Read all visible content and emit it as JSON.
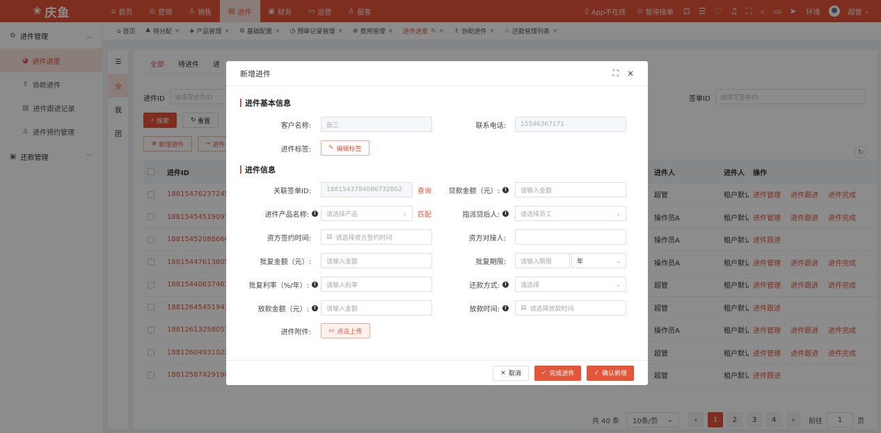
{
  "app": {
    "logo_text": "庆鱼"
  },
  "topnav": [
    {
      "label": "首页",
      "icon": "⌂"
    },
    {
      "label": "营销",
      "icon": "◎"
    },
    {
      "label": "销售",
      "icon": "♙"
    },
    {
      "label": "进件",
      "icon": "▤"
    },
    {
      "label": "财务",
      "icon": "▣"
    },
    {
      "label": "运营",
      "icon": "▭"
    },
    {
      "label": "服客",
      "icon": "♙"
    }
  ],
  "topright": {
    "app_status": "App不在线",
    "stop_accept": "暂停接单",
    "env": "环境",
    "user": "超管"
  },
  "sidebar": {
    "group1": "进件管理",
    "items": [
      "进件进度",
      "协助进件",
      "进件跟进记录",
      "进件预约管理"
    ],
    "group2": "还款管理"
  },
  "tabs": [
    {
      "label": "首页"
    },
    {
      "label": "待分配"
    },
    {
      "label": "产品管理"
    },
    {
      "label": "基础配置"
    },
    {
      "label": "预审记录管理"
    },
    {
      "label": "费用管理"
    },
    {
      "label": "进件进度"
    },
    {
      "label": "协助进件"
    },
    {
      "label": "还款管理列表"
    }
  ],
  "vtabs": [
    "全",
    "我",
    "团"
  ],
  "ptabs": [
    "全部",
    "待进件",
    "进"
  ],
  "filters": {
    "id_label": "进件ID",
    "id_placeholder": "请填写进件ID",
    "sign_label": "签单ID",
    "sign_placeholder": "请填写签单ID",
    "search": "搜索",
    "reset": "重置",
    "add": "新增进件",
    "more": "进件"
  },
  "table": {
    "headers": {
      "id": "进件ID",
      "person": "进件人",
      "type": "进件人",
      "ops": "操作"
    },
    "rows": [
      {
        "id": "1881547623724580",
        "person": "超管",
        "type": "租户默认",
        "ops": [
          "进件管理",
          "进件跟进",
          "进件完成"
        ]
      },
      {
        "id": "1881545451909770",
        "person": "操作员A",
        "type": "租户默认",
        "ops": [
          "进件管理",
          "进件跟进",
          "进件完成"
        ]
      },
      {
        "id": "1881545208866630",
        "person": "操作员A",
        "type": "租户默认",
        "ops": [
          "进件跟进"
        ]
      },
      {
        "id": "1881544761380530",
        "person": "操作员A",
        "type": "租户默认",
        "ops": [
          "进件管理",
          "进件跟进",
          "进件完成"
        ]
      },
      {
        "id": "1881544063746140",
        "person": "超管",
        "type": "租户默认",
        "ops": [
          "进件管理",
          "进件跟进",
          "进件完成"
        ]
      },
      {
        "id": "1881264545194140",
        "person": "超管",
        "type": "租户默认",
        "ops": [
          "进件跟进"
        ]
      },
      {
        "id": "1881261325805780",
        "person": "操作员A",
        "type": "租户默认",
        "ops": [
          "进件管理",
          "进件跟进",
          "进件完成"
        ]
      },
      {
        "id": "1881260493102210",
        "person": "超管",
        "type": "租户默认",
        "ops": [
          "进件管理",
          "进件跟进",
          "进件完成"
        ]
      },
      {
        "id": "1881258742919820",
        "person": "超管",
        "type": "租户默认",
        "ops": [
          "进件跟进"
        ]
      }
    ]
  },
  "pager": {
    "total": "共 40 条",
    "size": "10条/页",
    "pages": [
      "1",
      "2",
      "3",
      "4"
    ],
    "goto": "前往",
    "goto_val": "1",
    "unit": "页"
  },
  "modal": {
    "title": "新增进件",
    "sec1": "进件基本信息",
    "customer_label": "客户名称:",
    "customer_value": "张三",
    "phone_label": "联系电话:",
    "phone_value": "15546367171",
    "tag_label": "进件标签:",
    "tag_btn": "编辑标签",
    "sec2": "进件信息",
    "sign_label": "关联签单ID:",
    "sign_value": "1881543784086732802",
    "query": "查询",
    "loan_label": "贷款金额（元）:",
    "loan_ph": "请输入金额",
    "product_label": "进件产品名称:",
    "product_ph": "请选择产品",
    "match": "匹配",
    "assignee_label": "指派贷后人:",
    "assignee_ph": "请选择员工",
    "fund_sign_label": "资方签约时间:",
    "fund_sign_ph": "请选择资方签约时间",
    "fund_contact_label": "资方对接人:",
    "approve_amt_label": "批复金额（元）:",
    "approve_amt_ph": "请输入金额",
    "approve_term_label": "批复期限:",
    "approve_term_ph": "请输入期限",
    "term_unit": "年",
    "rate_label": "批复利率（%/年）:",
    "rate_ph": "请输入利率",
    "repay_label": "还款方式:",
    "repay_ph": "请选择",
    "disburse_amt_label": "放款金额（元）:",
    "disburse_amt_ph": "请输入金额",
    "disburse_time_label": "放款时间:",
    "disburse_time_ph": "请选择放款时间",
    "attach_label": "进件附件:",
    "upload": "点击上传",
    "cancel": "取消",
    "complete": "完成进件",
    "confirm": "确认新增"
  },
  "colors": {
    "accent": "#e4553a"
  }
}
